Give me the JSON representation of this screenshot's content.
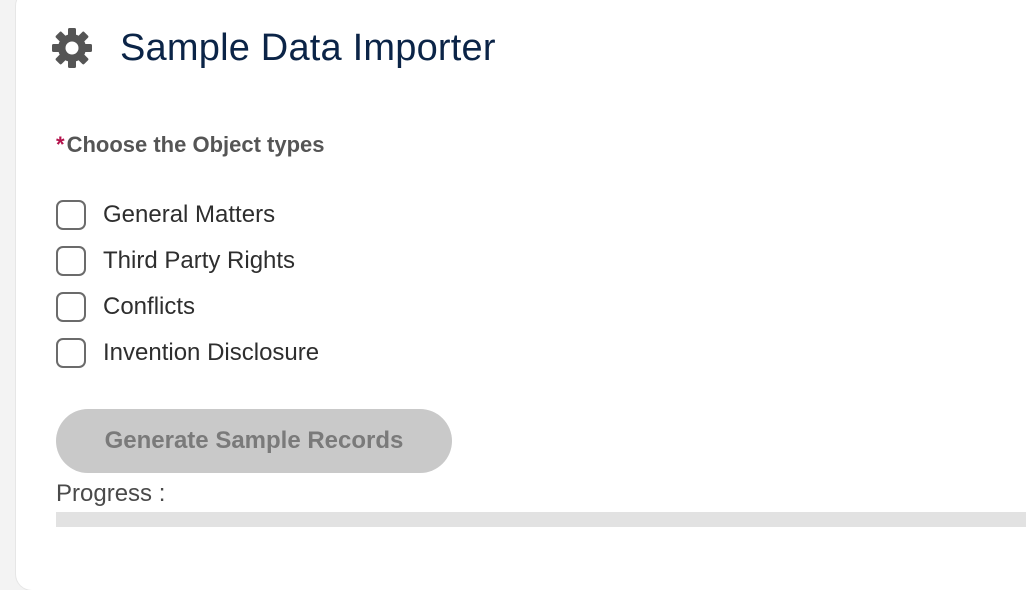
{
  "header": {
    "title": "Sample Data Importer",
    "icon": "gear-icon"
  },
  "form": {
    "required_marker": "*",
    "label": "Choose the Object types",
    "options": [
      {
        "label": "General Matters",
        "checked": false
      },
      {
        "label": "Third Party Rights",
        "checked": false
      },
      {
        "label": "Conflicts",
        "checked": false
      },
      {
        "label": "Invention Disclosure",
        "checked": false
      }
    ]
  },
  "actions": {
    "generate_label": "Generate Sample Records",
    "generate_disabled": true
  },
  "progress": {
    "label": "Progress :",
    "value": 0
  },
  "colors": {
    "title": "#0b2447",
    "required": "#b3124b",
    "button_disabled_bg": "#c9c9c9",
    "button_disabled_text": "#7a7a7a",
    "progress_track": "#e2e2e2"
  }
}
